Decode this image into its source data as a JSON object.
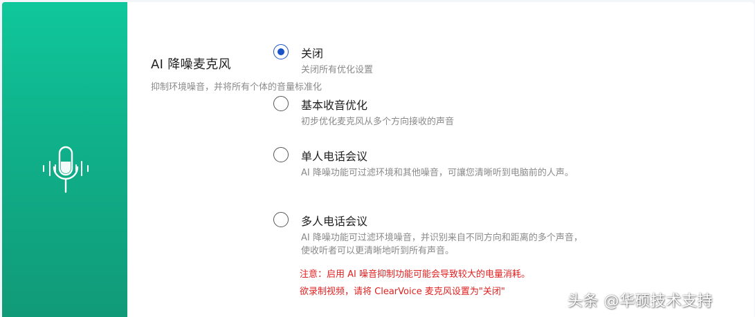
{
  "sidebar": {
    "icon": "microphone-noise-reduction-icon",
    "gradient_top": "#10c79c",
    "gradient_bottom": "#119a78"
  },
  "setting": {
    "title": "AI 降噪麦克风",
    "description": "抑制环境噪音，并将所有个体的音量标准化"
  },
  "options": [
    {
      "label": "关闭",
      "description": "关闭所有优化设置",
      "selected": true
    },
    {
      "label": "基本收音优化",
      "description": "初步优化麦克风从多个方向接收的声音",
      "selected": false
    },
    {
      "label": "单人电话会议",
      "description": "AI 降噪功能可过滤环境和其他噪音，可讓您清晰听到电脑前的人声。",
      "selected": false
    },
    {
      "label": "多人电话会议",
      "description": "AI 降噪功能可过滤环境噪音，并识别来自不同方向和距离的多个声音，使收听者可以更清晰地听到所有声音。",
      "selected": false
    }
  ],
  "warnings": {
    "line1": "注意：启用 AI 噪音抑制功能可能会导致较大的电量消耗。",
    "line2": "欲录制视频，请将 ClearVoice 麦克风设置为\"关闭\""
  },
  "watermark": "头条 @华硕技术支持",
  "colors": {
    "accent": "#1a52c8",
    "warning": "#e02020"
  }
}
